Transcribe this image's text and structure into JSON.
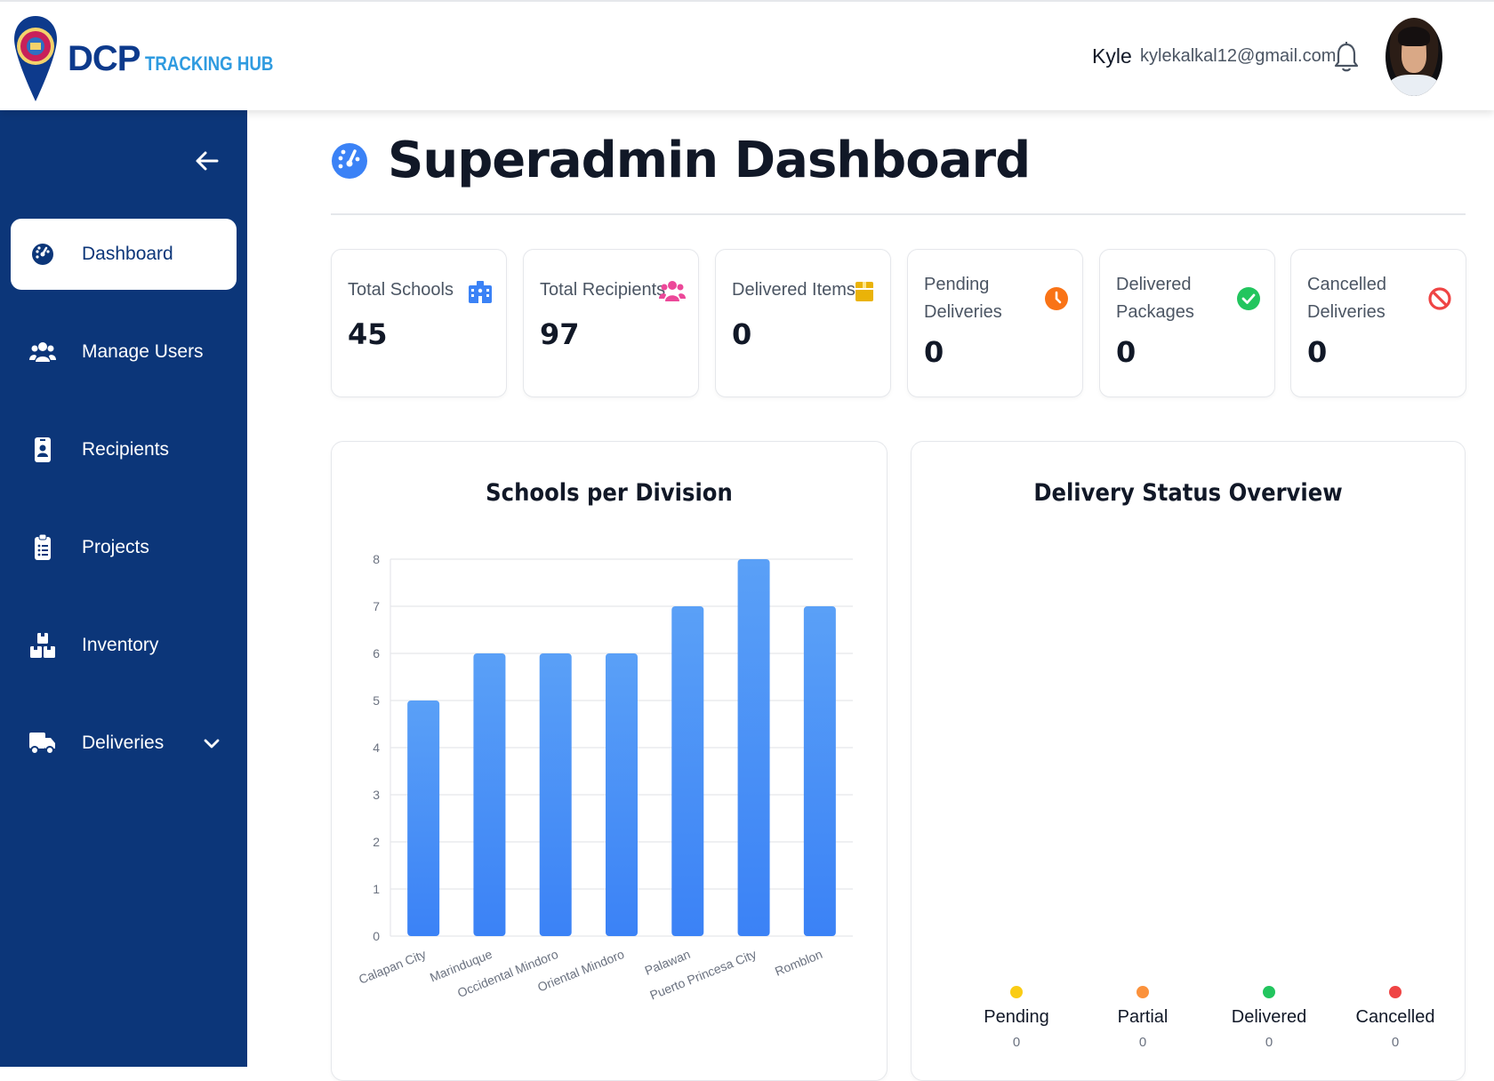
{
  "brand": {
    "name": "DCP",
    "tagline": "TRACKING HUB"
  },
  "user": {
    "name": "Kyle",
    "email": "kylekalkal12@gmail.com"
  },
  "sidebar": {
    "items": [
      {
        "label": "Dashboard",
        "icon": "gauge-icon",
        "active": true
      },
      {
        "label": "Manage Users",
        "icon": "users-icon"
      },
      {
        "label": "Recipients",
        "icon": "id-badge-icon"
      },
      {
        "label": "Projects",
        "icon": "clipboard-list-icon"
      },
      {
        "label": "Inventory",
        "icon": "boxes-icon"
      },
      {
        "label": "Deliveries",
        "icon": "truck-icon",
        "has_submenu": true
      }
    ]
  },
  "page": {
    "title": "Superadmin Dashboard"
  },
  "stats": [
    {
      "label": "Total Schools",
      "value": "45",
      "icon": "school-icon",
      "color": "#3b82f6"
    },
    {
      "label": "Total Recipients",
      "value": "97",
      "icon": "users-icon",
      "color": "#ec4899"
    },
    {
      "label": "Delivered Items",
      "value": "0",
      "icon": "box-icon",
      "color": "#eab308"
    },
    {
      "label": "Pending Deliveries",
      "value": "0",
      "icon": "clock-icon",
      "color": "#f97316"
    },
    {
      "label": "Delivered Packages",
      "value": "0",
      "icon": "check-circle-icon",
      "color": "#22c55e"
    },
    {
      "label": "Cancelled Deliveries",
      "value": "0",
      "icon": "ban-icon",
      "color": "#ef4444"
    }
  ],
  "chart_data": [
    {
      "type": "bar",
      "title": "Schools per Division",
      "categories": [
        "Calapan City",
        "Marinduque",
        "Occidental Mindoro",
        "Oriental Mindoro",
        "Palawan",
        "Puerto Princesa City",
        "Romblon"
      ],
      "values": [
        5,
        6,
        6,
        6,
        7,
        8,
        7
      ],
      "ylim": [
        0,
        8
      ],
      "yticks": [
        0,
        1,
        2,
        3,
        4,
        5,
        6,
        7,
        8
      ],
      "grid": true,
      "color": "#4a90f5"
    },
    {
      "type": "pie",
      "title": "Delivery Status Overview",
      "categories": [
        "Pending",
        "Partial",
        "Delivered",
        "Cancelled"
      ],
      "values": [
        0,
        0,
        0,
        0
      ],
      "colors": [
        "#facc15",
        "#fb923c",
        "#22c55e",
        "#ef4444"
      ],
      "legend": "bottom"
    }
  ]
}
